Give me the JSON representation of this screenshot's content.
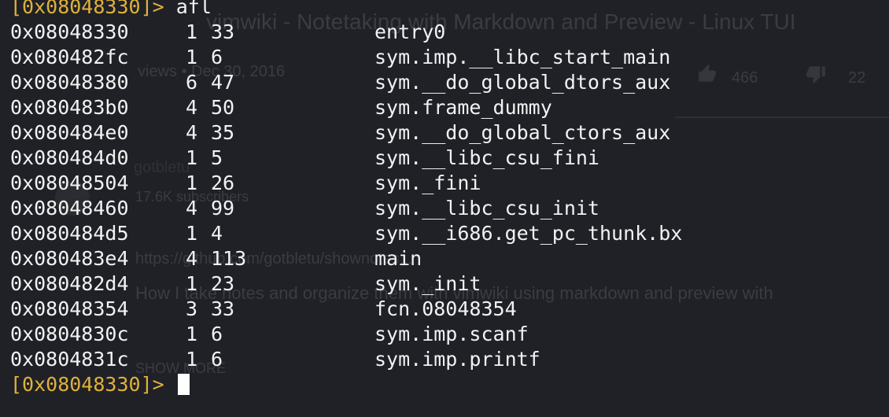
{
  "background_page": {
    "title": "vimwiki - Notetaking with Markdown and Preview - Linux TUI",
    "meta": "views • Dec 30, 2016",
    "likes": "466",
    "dislikes": "22",
    "channel": "gotbletu",
    "subscribers": "17.6K subscribers",
    "link": "https://github.com/gotbletu/shownotes...",
    "description": "How I take notes and organize them with vimwiki using markdown and preview with",
    "show_more": "SHOW MORE"
  },
  "terminal": {
    "prompt_color": "#e0b13a",
    "prompt": "[0x08048330]>",
    "command": "afl",
    "rows": [
      {
        "addr": "0x08048330",
        "nbbs": "1",
        "size": "33",
        "name": "entry0"
      },
      {
        "addr": "0x080482fc",
        "nbbs": "1",
        "size": "6",
        "name": "sym.imp.__libc_start_main"
      },
      {
        "addr": "0x08048380",
        "nbbs": "6",
        "size": "47",
        "name": "sym.__do_global_dtors_aux"
      },
      {
        "addr": "0x080483b0",
        "nbbs": "4",
        "size": "50",
        "name": "sym.frame_dummy"
      },
      {
        "addr": "0x080484e0",
        "nbbs": "4",
        "size": "35",
        "name": "sym.__do_global_ctors_aux"
      },
      {
        "addr": "0x080484d0",
        "nbbs": "1",
        "size": "5",
        "name": "sym.__libc_csu_fini"
      },
      {
        "addr": "0x08048504",
        "nbbs": "1",
        "size": "26",
        "name": "sym._fini"
      },
      {
        "addr": "0x08048460",
        "nbbs": "4",
        "size": "99",
        "name": "sym.__libc_csu_init"
      },
      {
        "addr": "0x080484d5",
        "nbbs": "1",
        "size": "4",
        "name": "sym.__i686.get_pc_thunk.bx"
      },
      {
        "addr": "0x080483e4",
        "nbbs": "4",
        "size": "113",
        "name": "main"
      },
      {
        "addr": "0x080482d4",
        "nbbs": "1",
        "size": "23",
        "name": "sym._init"
      },
      {
        "addr": "0x08048354",
        "nbbs": "3",
        "size": "33",
        "name": "fcn.08048354"
      },
      {
        "addr": "0x0804830c",
        "nbbs": "1",
        "size": "6",
        "name": "sym.imp.scanf"
      },
      {
        "addr": "0x0804831c",
        "nbbs": "1",
        "size": "6",
        "name": "sym.imp.printf"
      }
    ],
    "final_prompt": "[0x08048330]>"
  }
}
